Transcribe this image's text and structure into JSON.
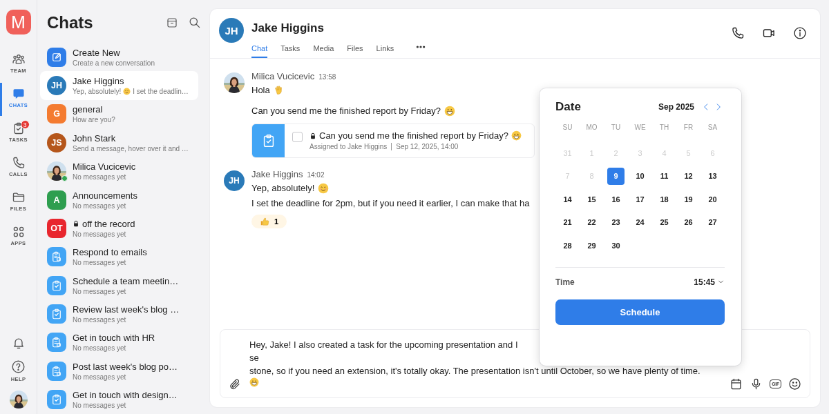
{
  "rail": {
    "logo": "M",
    "items": [
      {
        "label": "TEAM",
        "selected": false
      },
      {
        "label": "CHATS",
        "selected": true
      },
      {
        "label": "TASKS",
        "selected": false,
        "badge": "3"
      },
      {
        "label": "CALLS",
        "selected": false
      },
      {
        "label": "FILES",
        "selected": false
      },
      {
        "label": "APPS",
        "selected": false
      }
    ],
    "bottom_items": [
      {
        "kind": "bell"
      },
      {
        "kind": "help",
        "label": "HELP"
      },
      {
        "kind": "avatar"
      }
    ]
  },
  "chats": {
    "title": "Chats",
    "items": [
      {
        "kind": "action",
        "name": "Create New",
        "preview": [
          "Create a new conversation"
        ],
        "selected": false,
        "locked": false,
        "online": false
      },
      {
        "kind": "person",
        "initials": "JH",
        "color": "#2a7ab8",
        "name": "Jake Higgins",
        "preview": [
          "Yep, absolutely!",
          "I set the deadlin…"
        ],
        "selected": true,
        "locked": false,
        "online": false
      },
      {
        "kind": "group",
        "initials": "G",
        "color": "#f47b30",
        "name": "general",
        "preview": [
          "How are you?"
        ],
        "selected": false,
        "locked": false,
        "online": false
      },
      {
        "kind": "person",
        "initials": "JS",
        "color": "#b5561b",
        "name": "John Stark",
        "preview": [
          "Send a message, hover over it and …"
        ],
        "selected": false,
        "locked": false,
        "online": false
      },
      {
        "name": "Milica Vucicevic",
        "preview": [
          "No messages yet"
        ],
        "selected": false,
        "locked": false,
        "online": true
      },
      {
        "kind": "group",
        "initials": "A",
        "color": "#2e9e4f",
        "name": "Announcements",
        "preview": [
          "No messages yet"
        ],
        "selected": false,
        "locked": false,
        "online": false
      },
      {
        "kind": "group",
        "initials": "OT",
        "color": "#e8262e",
        "name": "off the record",
        "preview": [
          "No messages yet"
        ],
        "selected": false,
        "locked": true,
        "online": false
      },
      {
        "kind": "checklist",
        "name": "Respond to emails",
        "preview": [
          "No messages yet"
        ],
        "selected": false,
        "locked": false,
        "online": false
      },
      {
        "kind": "task",
        "name": "Schedule a team meetin…",
        "preview": [
          "No messages yet"
        ],
        "selected": false,
        "locked": false,
        "online": false
      },
      {
        "kind": "task",
        "name": "Review last week's blog …",
        "preview": [
          "No messages yet"
        ],
        "selected": false,
        "locked": false,
        "online": false
      },
      {
        "kind": "checklist",
        "name": "Get in touch with HR",
        "preview": [
          "No messages yet"
        ],
        "selected": false,
        "locked": false,
        "online": false
      },
      {
        "kind": "checklist",
        "name": "Post last week's blog po…",
        "preview": [
          "No messages yet"
        ],
        "selected": false,
        "locked": false,
        "online": false
      },
      {
        "kind": "task",
        "name": "Get in touch with design…",
        "preview": [
          "No messages yet"
        ],
        "selected": false,
        "locked": false,
        "online": false
      }
    ]
  },
  "conversation": {
    "contact": {
      "initials": "JH",
      "color": "#2a7ab8",
      "name": "Jake Higgins"
    },
    "tabs": [
      {
        "label": "Chat",
        "selected": true
      },
      {
        "label": "Tasks",
        "selected": false
      },
      {
        "label": "Media",
        "selected": false
      },
      {
        "label": "Files",
        "selected": false
      },
      {
        "label": "Links",
        "selected": false
      }
    ],
    "messages": [
      {
        "author": "Milica Vucicevic",
        "time": "13:58",
        "lines": [
          {
            "text": "Hola",
            "kind": "wave"
          },
          {
            "text": "Can you send me the finished report by Friday?",
            "kind": "grin"
          }
        ],
        "task": {
          "checked": false,
          "locked": true,
          "title": "Can you send me the finished report by Friday?",
          "assignee": "Assigned to Jake Higgins",
          "due": "Sep 12, 2025, 14:00"
        }
      },
      {
        "author": "Jake Higgins",
        "time": "14:02",
        "initials": "JH",
        "color": "#2a7ab8",
        "lines": [
          {
            "text": "Yep, absolutely!",
            "kind": "smile"
          },
          {
            "text": "I set the deadline for 2pm, but if you need it earlier, I can make that ha",
            "kind": "plain"
          }
        ],
        "reactions": [
          {
            "count": "1"
          }
        ]
      }
    ],
    "composer": {
      "lines": [
        "Hey, Jake! I also created a task for the upcoming presentation and I se",
        "stone, so if you need an extension, it's totally okay. The presentation isn't until October, so we have plenty of time."
      ],
      "gif": "GIF"
    }
  },
  "date_picker": {
    "title": "Date",
    "month": "Sep 2025",
    "weekdays": [
      "SU",
      "MO",
      "TU",
      "WE",
      "TH",
      "FR",
      "SA"
    ],
    "weeks": [
      [
        {
          "day": "31",
          "muted": true,
          "selected": false
        },
        {
          "day": "1",
          "muted": true,
          "selected": false
        },
        {
          "day": "2",
          "muted": true,
          "selected": false
        },
        {
          "day": "3",
          "muted": true,
          "selected": false
        },
        {
          "day": "4",
          "muted": true,
          "selected": false
        },
        {
          "day": "5",
          "muted": true,
          "selected": false
        },
        {
          "day": "6",
          "muted": true,
          "selected": false
        }
      ],
      [
        {
          "day": "7",
          "muted": true,
          "selected": false
        },
        {
          "day": "8",
          "muted": true,
          "selected": false
        },
        {
          "day": "9",
          "muted": false,
          "selected": true
        },
        {
          "day": "10",
          "muted": false,
          "selected": false
        },
        {
          "day": "11",
          "muted": false,
          "selected": false
        },
        {
          "day": "12",
          "muted": false,
          "selected": false
        },
        {
          "day": "13",
          "muted": false,
          "selected": false
        }
      ],
      [
        {
          "day": "14",
          "muted": false,
          "selected": false
        },
        {
          "day": "15",
          "muted": false,
          "selected": false
        },
        {
          "day": "16",
          "muted": false,
          "selected": false
        },
        {
          "day": "17",
          "muted": false,
          "selected": false
        },
        {
          "day": "18",
          "muted": false,
          "selected": false
        },
        {
          "day": "19",
          "muted": false,
          "selected": false
        },
        {
          "day": "20",
          "muted": false,
          "selected": false
        }
      ],
      [
        {
          "day": "21",
          "muted": false,
          "selected": false
        },
        {
          "day": "22",
          "muted": false,
          "selected": false
        },
        {
          "day": "23",
          "muted": false,
          "selected": false
        },
        {
          "day": "24",
          "muted": false,
          "selected": false
        },
        {
          "day": "25",
          "muted": false,
          "selected": false
        },
        {
          "day": "26",
          "muted": false,
          "selected": false
        },
        {
          "day": "27",
          "muted": false,
          "selected": false
        }
      ],
      [
        {
          "day": "28",
          "muted": false,
          "selected": false
        },
        {
          "day": "29",
          "muted": false,
          "selected": false
        },
        {
          "day": "30",
          "muted": false,
          "selected": false
        }
      ]
    ],
    "time_label": "Time",
    "time": "15:45",
    "button": "Schedule"
  }
}
